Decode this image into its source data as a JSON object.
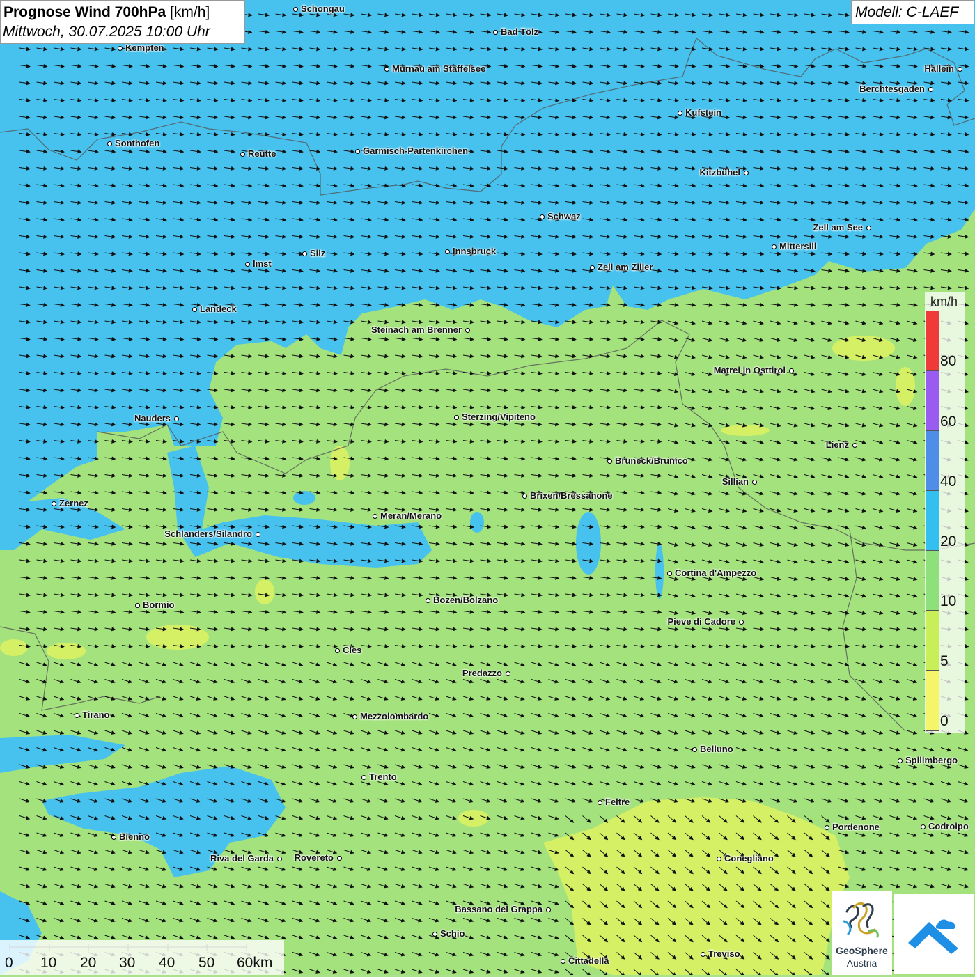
{
  "title": {
    "bold": "Prognose Wind 700hPa",
    "unit": "[km/h]",
    "date": "Mittwoch, 30.07.2025 10:00 Uhr"
  },
  "model_label": "Modell: C-LAEF",
  "legend": {
    "unit": "km/h",
    "ticks": [
      "80",
      "60",
      "40",
      "20",
      "10",
      "5",
      "0"
    ],
    "colors": {
      "0-5": "#f5f56a",
      "5-10": "#c8ef58",
      "10-20": "#8ee07b",
      "20-40": "#33bff0",
      "40-60": "#4f8ee8",
      "60-80": "#9a5cf0",
      "80+": "#f03a3a"
    }
  },
  "map_colors": {
    "strong": "#47c2ee",
    "medium": "#a4e27e",
    "weak": "#d6f066"
  },
  "scale_bar": {
    "labels": [
      "0",
      "10",
      "20",
      "30",
      "40",
      "50",
      "60km"
    ]
  },
  "cities": [
    {
      "name": "Schongau"
    },
    {
      "name": "Bad Tölz"
    },
    {
      "name": "Kempten"
    },
    {
      "name": "Murnau am Staffelsee"
    },
    {
      "name": "Hallein"
    },
    {
      "name": "Berchtesgaden"
    },
    {
      "name": "Kufstein"
    },
    {
      "name": "Sonthofen"
    },
    {
      "name": "Reutte"
    },
    {
      "name": "Garmisch-Partenkirchen"
    },
    {
      "name": "Kitzbühel"
    },
    {
      "name": "Schwaz"
    },
    {
      "name": "Zell am See"
    },
    {
      "name": "Mittersill"
    },
    {
      "name": "Silz"
    },
    {
      "name": "Innsbruck"
    },
    {
      "name": "Imst"
    },
    {
      "name": "Zell am Ziller"
    },
    {
      "name": "Landeck"
    },
    {
      "name": "Steinach am Brenner"
    },
    {
      "name": "Matrei in Osttirol"
    },
    {
      "name": "Nauders"
    },
    {
      "name": "Sterzing/Vipiteno"
    },
    {
      "name": "Lienz"
    },
    {
      "name": "Bruneck/Brunico"
    },
    {
      "name": "Sillian"
    },
    {
      "name": "Brixen/Bressanone"
    },
    {
      "name": "Zernez"
    },
    {
      "name": "Meran/Merano"
    },
    {
      "name": "Schlanders/Silandro"
    },
    {
      "name": "Cortina d'Ampezzo"
    },
    {
      "name": "Bormio"
    },
    {
      "name": "Bozen/Bolzano"
    },
    {
      "name": "Pieve di Cadore"
    },
    {
      "name": "Cles"
    },
    {
      "name": "Predazzo"
    },
    {
      "name": "Tirano"
    },
    {
      "name": "Mezzolombardo"
    },
    {
      "name": "Belluno"
    },
    {
      "name": "Spilimbergo"
    },
    {
      "name": "Trento"
    },
    {
      "name": "Feltre"
    },
    {
      "name": "Pordenone"
    },
    {
      "name": "Codroipo"
    },
    {
      "name": "Bienno"
    },
    {
      "name": "Riva del Garda"
    },
    {
      "name": "Rovereto"
    },
    {
      "name": "Conegliano"
    },
    {
      "name": "Bassano del Grappa"
    },
    {
      "name": "Schio"
    },
    {
      "name": "Treviso"
    },
    {
      "name": "Cittadella"
    }
  ],
  "logo": {
    "line1": "GeoSphere",
    "line2": "Austria"
  }
}
